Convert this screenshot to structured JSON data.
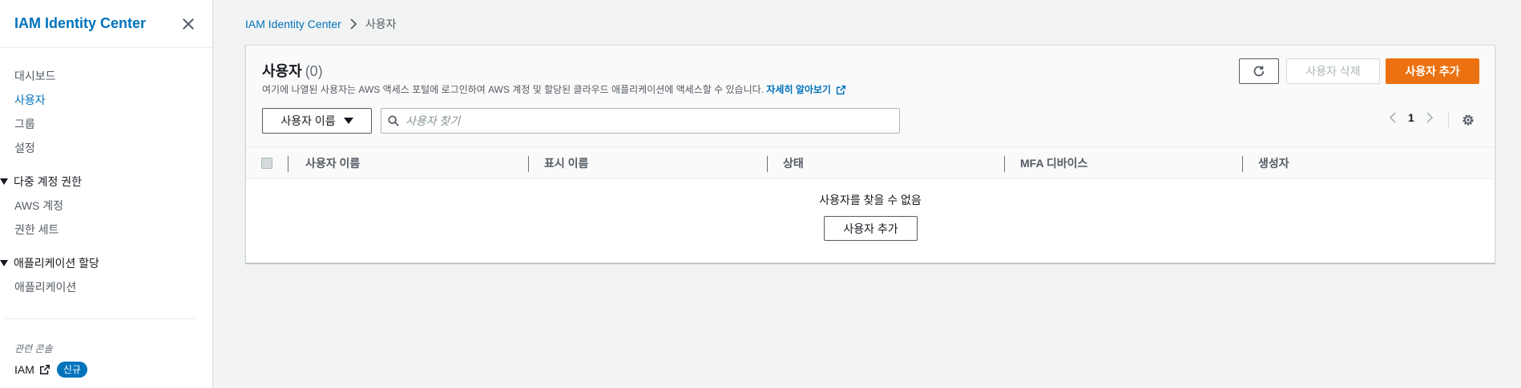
{
  "sidebar": {
    "title": "IAM Identity Center",
    "items_top": [
      {
        "label": "대시보드",
        "active": false
      },
      {
        "label": "사용자",
        "active": true
      },
      {
        "label": "그룹",
        "active": false
      },
      {
        "label": "설정",
        "active": false
      }
    ],
    "section_multi": "다중 계정 권한",
    "multi_items": [
      "AWS 계정",
      "권한 세트"
    ],
    "section_apps": "애플리케이션 할당",
    "app_items": [
      "애플리케이션"
    ],
    "related_label": "관련 콘솔",
    "iam_link": "IAM",
    "new_badge": "신규"
  },
  "breadcrumb": {
    "root": "IAM Identity Center",
    "current": "사용자"
  },
  "panel": {
    "title": "사용자",
    "count": "(0)",
    "description": "여기에 나열된 사용자는 AWS 액세스 포털에 로그인하여 AWS 계정 및 할당된 클라우드 애플리케이션에 액세스할 수 있습니다.",
    "learn_more": "자세히 알아보기",
    "delete_label": "사용자 삭제",
    "add_label": "사용자 추가",
    "filter_label": "사용자 이름",
    "search_placeholder": "사용자 찾기",
    "page": "1",
    "columns": [
      "사용자 이름",
      "표시 이름",
      "상태",
      "MFA 디바이스",
      "생성자"
    ],
    "empty_text": "사용자를 찾을 수 없음",
    "empty_add_label": "사용자 추가"
  },
  "colors": {
    "primary": "#ec7211",
    "link": "#0073bb",
    "badge": "#0073bb"
  }
}
